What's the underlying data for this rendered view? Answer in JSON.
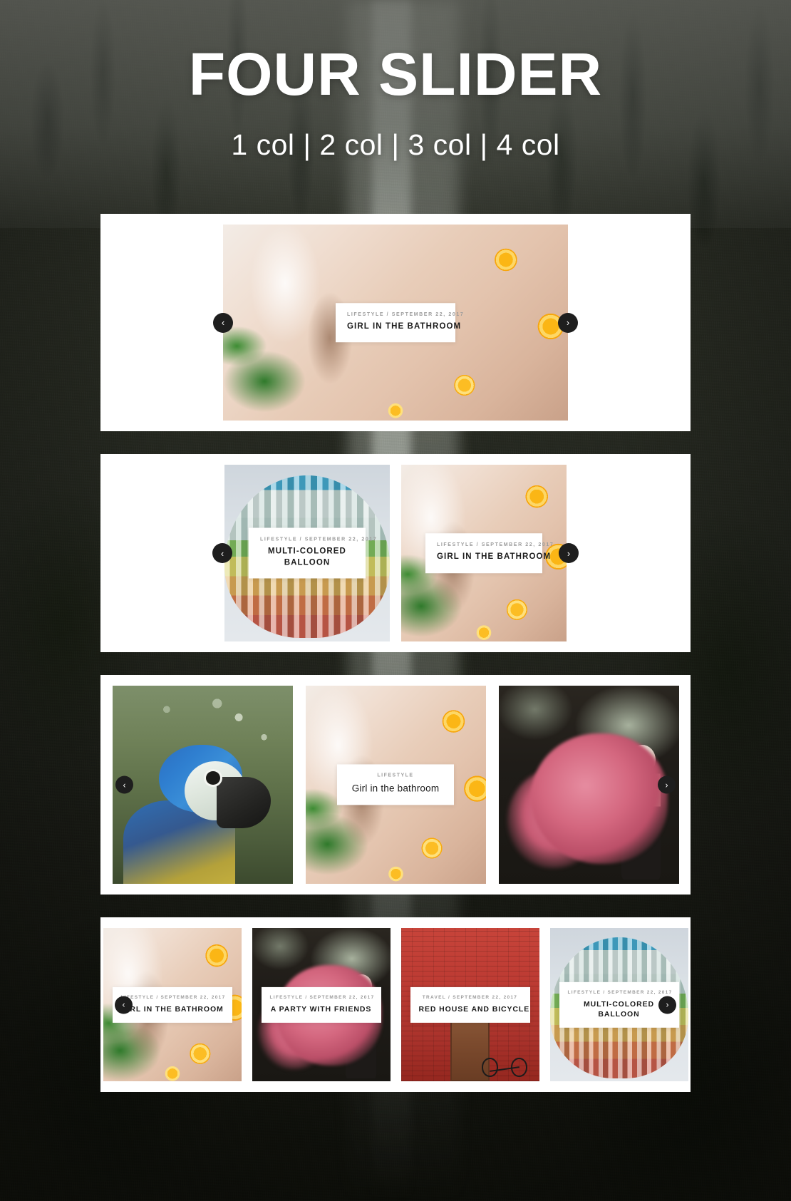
{
  "hero": {
    "title": "FOUR SLIDER",
    "subtitle": "1 col | 2 col | 3 col | 4 col"
  },
  "icons": {
    "prev": "‹",
    "next": "›"
  },
  "colors": {
    "panel_bg": "#ffffff",
    "arrow_bg": "#1e1e1e",
    "arrow_fg": "#ffffff",
    "caption_bg": "#ffffff",
    "caption_title": "#1b1b1b",
    "caption_meta": "#9b9b9b",
    "hero_text": "#ffffff"
  },
  "sliders": [
    {
      "name": "one-column-slider",
      "columns": 1,
      "slides": [
        {
          "photo": "girl-in-the-bathroom",
          "meta": "LIFESTYLE / SEPTEMBER 22, 2017",
          "title": "GIRL IN THE BATHROOM"
        }
      ]
    },
    {
      "name": "two-column-slider",
      "columns": 2,
      "slides": [
        {
          "photo": "multi-colored-balloon",
          "meta": "LIFESTYLE / SEPTEMBER 22, 2017",
          "title": "MULTI-COLORED BALLOON"
        },
        {
          "photo": "girl-in-the-bathroom",
          "meta": "LIFESTYLE / SEPTEMBER 22, 2017",
          "title": "GIRL IN THE BATHROOM"
        }
      ]
    },
    {
      "name": "three-column-slider",
      "columns": 3,
      "slides": [
        {
          "photo": "parrot",
          "meta": "",
          "title": ""
        },
        {
          "photo": "girl-in-the-bathroom",
          "meta": "LIFESTYLE",
          "title": "Girl in the bathroom"
        },
        {
          "photo": "pink-smoke",
          "meta": "",
          "title": ""
        }
      ]
    },
    {
      "name": "four-column-slider",
      "columns": 4,
      "slides": [
        {
          "photo": "girl-in-the-bathroom",
          "meta": "LIFESTYLE / SEPTEMBER 22, 2017",
          "title": "GIRL IN THE BATHROOM"
        },
        {
          "photo": "pink-smoke",
          "meta": "LIFESTYLE / SEPTEMBER 22, 2017",
          "title": "A PARTY WITH FRIENDS"
        },
        {
          "photo": "red-house-and-bicycle",
          "meta": "TRAVEL / SEPTEMBER 22, 2017",
          "title": "RED HOUSE AND BICYCLE"
        },
        {
          "photo": "multi-colored-balloon",
          "meta": "LIFESTYLE / SEPTEMBER 22, 2017",
          "title": "MULTI-COLORED BALLOON"
        }
      ]
    }
  ]
}
